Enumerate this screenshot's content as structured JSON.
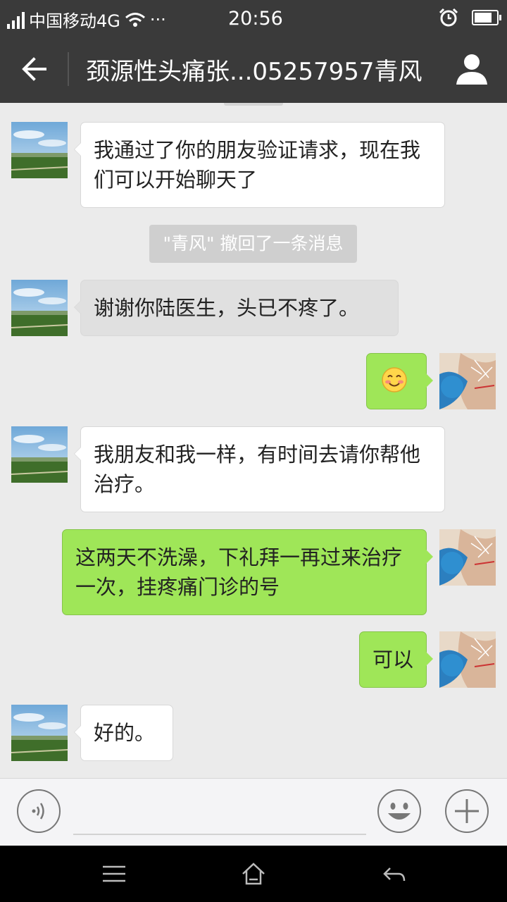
{
  "status_bar": {
    "carrier": "中国移动4G",
    "more": "···",
    "time": "20:56",
    "battery_level": 0.8
  },
  "title_bar": {
    "title": "颈源性头痛张...05257957青风"
  },
  "messages": [
    {
      "side": "in",
      "text": "我通过了你的朋友验证请求，现在我们可以开始聊天了"
    },
    {
      "type": "system",
      "text": "\"青风\" 撤回了一条消息"
    },
    {
      "side": "in",
      "text": "谢谢你陆医生，头已不疼了。"
    },
    {
      "side": "out",
      "emoji": "smiling-face-icon"
    },
    {
      "side": "in",
      "text": "我朋友和我一样，有时间去请你帮他治疗。"
    },
    {
      "side": "out",
      "text": "这两天不洗澡，下礼拜一再过来治疗一次，挂疼痛门诊的号"
    },
    {
      "side": "out",
      "text": "可以"
    },
    {
      "side": "in",
      "text": "好的。"
    }
  ],
  "input_bar": {
    "voice_icon": "voice-icon",
    "emoji_icon": "emoji-icon",
    "plus_icon": "plus-icon"
  },
  "colors": {
    "header_bg": "#3a3a3a",
    "chat_bg": "#ebebeb",
    "outgoing_bubble": "#9fe658",
    "incoming_bubble": "#ffffff"
  }
}
